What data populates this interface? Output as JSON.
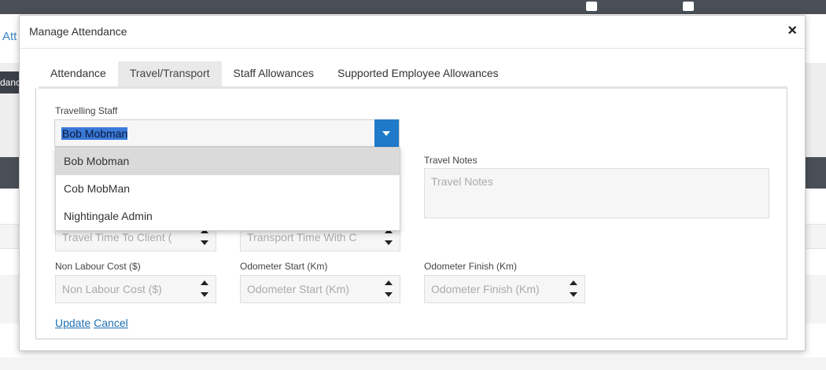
{
  "background": {
    "link_text": "Att",
    "tag_text": "dance"
  },
  "modal": {
    "title": "Manage Attendance",
    "close_label": "×"
  },
  "tabs": [
    {
      "label": "Attendance"
    },
    {
      "label": "Travel/Transport"
    },
    {
      "label": "Staff Allowances"
    },
    {
      "label": "Supported Employee Allowances"
    }
  ],
  "form": {
    "travelling_staff": {
      "label": "Travelling Staff",
      "value": "Bob Mobman",
      "options": [
        "Bob Mobman",
        "Cob MobMan",
        "Nightingale Admin"
      ]
    },
    "travel_notes": {
      "label": "Travel Notes",
      "placeholder": "Travel Notes"
    },
    "travel_time_to_client": {
      "placeholder": "Travel Time To Client ("
    },
    "transport_time_with_client": {
      "placeholder": "Transport Time With C"
    },
    "non_labour_cost": {
      "label": "Non Labour Cost ($)",
      "placeholder": "Non Labour Cost ($)"
    },
    "odometer_start": {
      "label": "Odometer Start (Km)",
      "placeholder": "Odometer Start (Km)"
    },
    "odometer_finish": {
      "label": "Odometer Finish (Km)",
      "placeholder": "Odometer Finish (Km)"
    }
  },
  "actions": {
    "update_label": "Update",
    "cancel_label": "Cancel"
  },
  "colors": {
    "accent": "#1f7bc9",
    "selection": "#3a79d8",
    "link": "#1f6fb4"
  }
}
